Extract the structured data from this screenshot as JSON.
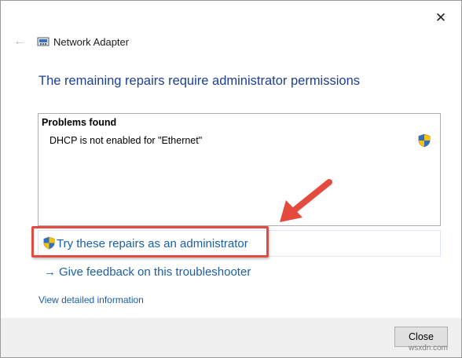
{
  "window": {
    "title": "Network Adapter",
    "close_glyph": "✕",
    "back_glyph": "←"
  },
  "main": {
    "heading": "The remaining repairs require administrator permissions",
    "problems": {
      "header": "Problems found",
      "items": [
        "DHCP is not enabled for \"Ethernet\""
      ]
    },
    "admin_option_label": "Try these repairs as an administrator",
    "feedback_label": "Give feedback on this troubleshooter",
    "feedback_arrow": "→",
    "detail_link": "View detailed information"
  },
  "footer": {
    "close_label": "Close"
  },
  "watermark": "wsxdn.com",
  "colors": {
    "heading": "#1c3f94",
    "link": "#1a5fa8",
    "highlight": "#e44a3e"
  }
}
